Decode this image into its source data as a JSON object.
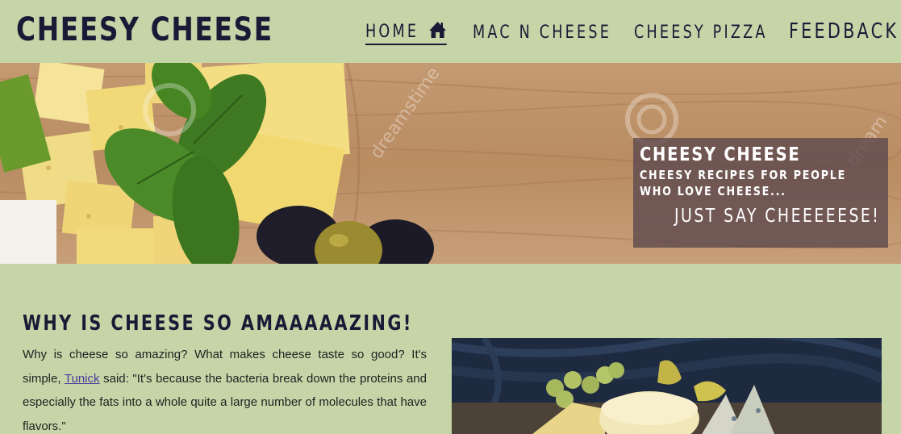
{
  "header": {
    "logo": "CHEESY CHEESE",
    "nav": [
      {
        "label": "HOME",
        "icon": "home-icon",
        "active": true
      },
      {
        "label": "MAC N CHEESE"
      },
      {
        "label": "CHEESY PIZZA"
      },
      {
        "label": "FEEDBACK"
      }
    ]
  },
  "hero": {
    "title": "CHEESY CHEESE",
    "subtitle": "CHEESY RECIPES FOR PEOPLE WHO LOVE CHEESE...",
    "tagline": "JUST SAY CHEEEEESE!",
    "watermark": "dreamstime"
  },
  "main": {
    "section_title": "WHY IS CHEESE SO AMAAAAAZING!",
    "para_intro": "Why is cheese so amazing? What makes cheese taste so good? It's simple, ",
    "link_text": "Tunick",
    "para_rest": " said: \"It's because the bacteria break down the proteins and especially the fats into a whole quite a large number of molecules that have flavors.\""
  },
  "colors": {
    "background": "#c5d5a8",
    "text": "#1b1a36",
    "caption_bg": "#5f4b4e",
    "link": "#4a3a9a"
  }
}
